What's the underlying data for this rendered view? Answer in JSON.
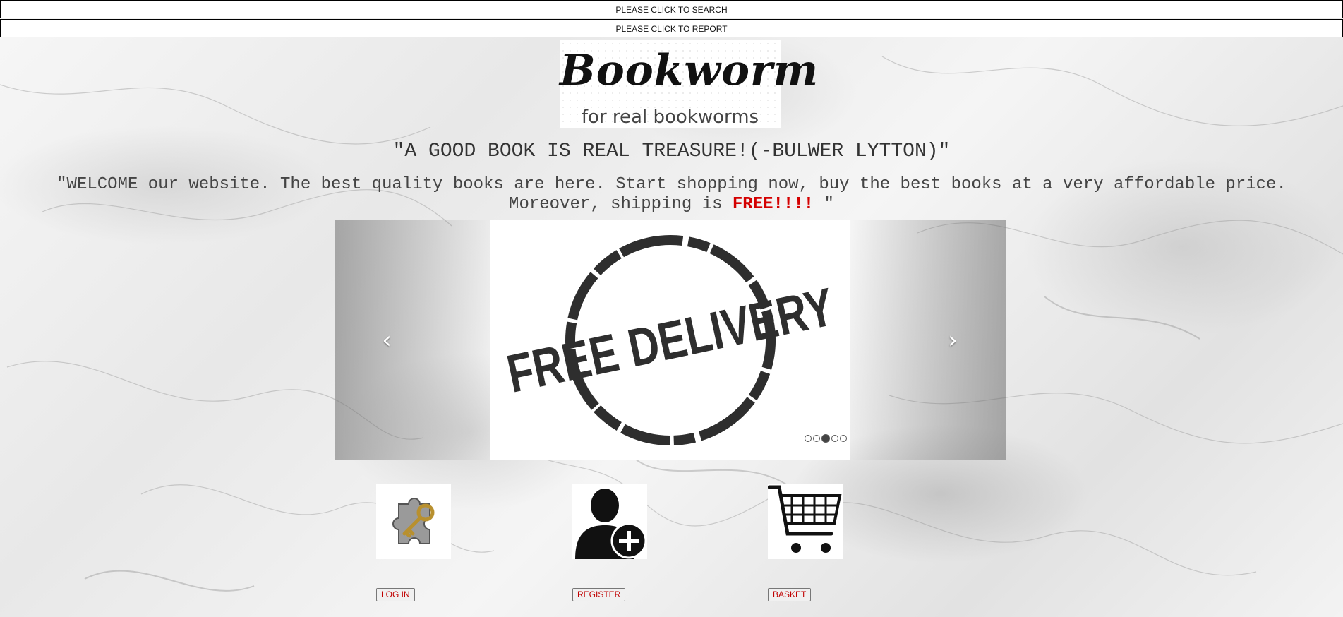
{
  "top_buttons": {
    "search": "PLEASE CLICK TO SEARCH",
    "report": "PLEASE CLICK TO REPORT"
  },
  "logo": {
    "title": "Bookworm",
    "subtitle": "for real bookworms"
  },
  "quote": "\"A GOOD BOOK IS REAL TREASURE!(-BULWER LYTTON)\"",
  "welcome": {
    "line1": "\"WELCOME our website. The best quality books are here. Start shopping now, buy the best books at a very affordable price.",
    "line2_prefix": "Moreover, shipping is ",
    "line2_free": "FREE!!!!",
    "line2_suffix": " \""
  },
  "carousel": {
    "slide_text": "FREE DELIVERY",
    "prev_icon": "chevron-left-icon",
    "next_icon": "chevron-right-icon",
    "indicator_count": 5,
    "active_index": 2
  },
  "nav": {
    "login": {
      "label": "LOG IN",
      "icon": "puzzle-key-icon"
    },
    "register": {
      "label": "REGISTER",
      "icon": "user-add-icon"
    },
    "basket": {
      "label": "BASKET",
      "icon": "shopping-cart-icon"
    }
  },
  "colors": {
    "free_text": "#d40000",
    "button_text": "#c00000"
  }
}
